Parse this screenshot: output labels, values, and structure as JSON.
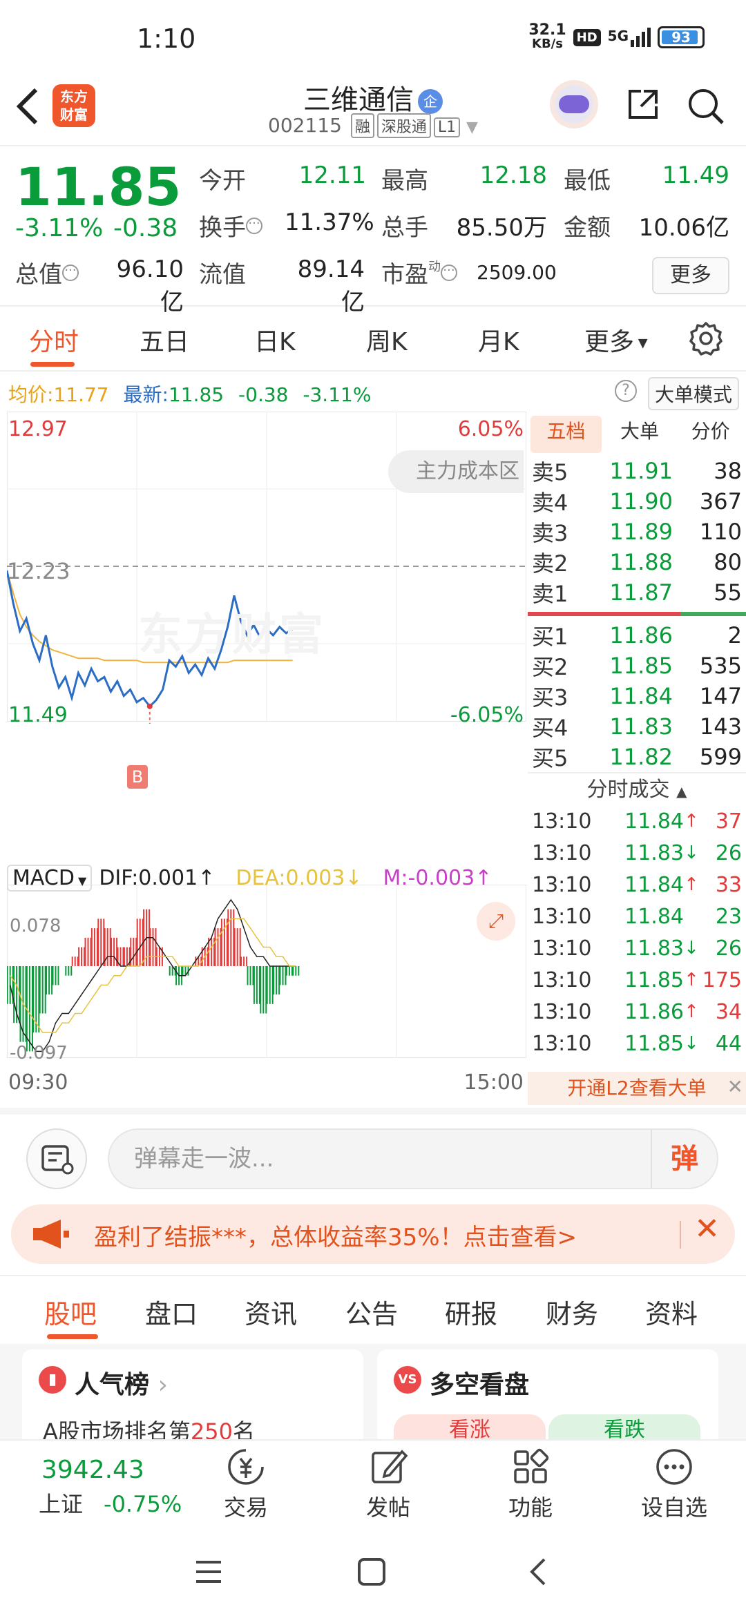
{
  "status": {
    "time": "1:10",
    "net_speed": "32.1",
    "net_unit": "KB/s",
    "hd": "HD",
    "signal": "5G",
    "battery": "93"
  },
  "header": {
    "back_icon": "chevron-left-icon",
    "logo_line1": "东方",
    "logo_line2": "财富",
    "stock_name": "三维通信",
    "badge": "企",
    "code": "002115",
    "tags": [
      "融",
      "深股通",
      "L1"
    ]
  },
  "quote": {
    "price": "11.85",
    "change_pct": "-3.11%",
    "change": "-0.38",
    "open_label": "今开",
    "open": "12.11",
    "high_label": "最高",
    "high": "12.18",
    "low_label": "最低",
    "low": "11.49",
    "turnover_label": "换手",
    "turnover": "11.37%",
    "volume_label": "总手",
    "volume": "85.50万",
    "amount_label": "金额",
    "amount": "10.06亿",
    "mktcap_label": "总值",
    "mktcap": "96.10亿",
    "float_label": "流值",
    "float": "89.14亿",
    "pe_label": "市盈",
    "pe_sup": "动",
    "pe": "2509.00",
    "more": "更多"
  },
  "period_tabs": [
    "分时",
    "五日",
    "日K",
    "周K",
    "月K",
    "更多"
  ],
  "info": {
    "avg_label": "均价:",
    "avg": "11.77",
    "latest_label": "最新:",
    "latest": "11.85",
    "latest_chg": "-0.38",
    "latest_pct": "-3.11%",
    "big_order": "大单模式"
  },
  "chart_labels": {
    "y_top": "12.97",
    "pct_top": "6.05%",
    "y_mid": "12.23",
    "y_bottom": "11.49",
    "pct_bottom": "-6.05%",
    "cost_zone": "主力成本区",
    "watermark": "东方财富",
    "b_marker": "B",
    "macd_selector": "MACD",
    "dif": "DIF:0.001",
    "dea": "DEA:0.003",
    "m": "M:-0.003",
    "macd_top": "0.078",
    "macd_bottom": "-0.097",
    "time_start": "09:30",
    "time_end": "15:00"
  },
  "chart_data": {
    "type": "line",
    "title": "",
    "xlim": [
      "09:30",
      "15:00"
    ],
    "ylim": [
      11.49,
      12.97
    ],
    "reference_price": 12.23,
    "series": [
      {
        "values": [
          12.21,
          12.05,
          11.92,
          11.98,
          11.86,
          11.78,
          11.9,
          11.75,
          11.65,
          11.7,
          11.6,
          11.72,
          11.66,
          11.74,
          11.68,
          11.7,
          11.63,
          11.68,
          11.61,
          11.64,
          11.58,
          11.6,
          11.56,
          11.59,
          11.64,
          11.78,
          11.75,
          11.8,
          11.72,
          11.76,
          11.71,
          11.79,
          11.74,
          11.83,
          11.94,
          12.09,
          11.97,
          11.9,
          11.95,
          11.89,
          11.93,
          11.9,
          11.94,
          11.91,
          11.93
        ]
      },
      {
        "values": [
          12.21,
          12.1,
          12.0,
          11.94,
          11.9,
          11.87,
          11.85,
          11.83,
          11.82,
          11.81,
          11.8,
          11.79,
          11.79,
          11.79,
          11.79,
          11.78,
          11.78,
          11.78,
          11.78,
          11.78,
          11.78,
          11.77,
          11.77,
          11.77,
          11.77,
          11.77,
          11.77,
          11.77,
          11.77,
          11.77,
          11.77,
          11.77,
          11.77,
          11.77,
          11.77,
          11.78,
          11.78,
          11.78,
          11.78,
          11.78,
          11.78,
          11.78,
          11.78,
          11.78,
          11.78
        ]
      }
    ],
    "macd": {
      "ylim": [
        -0.097,
        0.078
      ],
      "bars": [
        -0.04,
        -0.06,
        -0.08,
        -0.09,
        -0.07,
        -0.05,
        -0.03,
        -0.02,
        0.0,
        -0.01,
        0.01,
        0.02,
        0.03,
        0.04,
        0.05,
        0.04,
        0.03,
        0.02,
        0.02,
        0.03,
        0.05,
        0.06,
        0.04,
        0.02,
        0.0,
        -0.01,
        -0.02,
        -0.01,
        0.0,
        0.01,
        0.02,
        0.03,
        0.04,
        0.05,
        0.06,
        0.04,
        0.01,
        -0.02,
        -0.04,
        -0.05,
        -0.04,
        -0.03,
        -0.02,
        -0.01,
        -0.01
      ],
      "dif": [
        -0.02,
        -0.05,
        -0.07,
        -0.08,
        -0.09,
        -0.09,
        -0.08,
        -0.06,
        -0.05,
        -0.05,
        -0.04,
        -0.03,
        -0.02,
        -0.01,
        0.0,
        0.01,
        0.01,
        0.0,
        0.0,
        0.01,
        0.02,
        0.03,
        0.03,
        0.02,
        0.01,
        0.0,
        -0.01,
        -0.01,
        0.0,
        0.01,
        0.02,
        0.03,
        0.05,
        0.06,
        0.07,
        0.06,
        0.04,
        0.02,
        0.01,
        0.01,
        0.0,
        0.0,
        0.0,
        0.0,
        0.0
      ],
      "dea": [
        -0.01,
        -0.02,
        -0.04,
        -0.05,
        -0.06,
        -0.07,
        -0.07,
        -0.07,
        -0.06,
        -0.06,
        -0.05,
        -0.05,
        -0.04,
        -0.03,
        -0.02,
        -0.02,
        -0.01,
        -0.01,
        0.0,
        0.0,
        0.0,
        0.01,
        0.01,
        0.01,
        0.01,
        0.01,
        0.0,
        0.0,
        0.0,
        0.0,
        0.01,
        0.02,
        0.03,
        0.04,
        0.05,
        0.05,
        0.05,
        0.04,
        0.03,
        0.02,
        0.02,
        0.01,
        0.01,
        0.0,
        0.0
      ]
    },
    "colors": {
      "price": "#2b6cc4",
      "avg": "#f2b33d",
      "up": "#e23b3b",
      "down": "#0a9b3b",
      "dif": "#222222",
      "dea": "#e7c23d"
    }
  },
  "book": {
    "tabs": [
      "五档",
      "大单",
      "分价"
    ],
    "sells": [
      {
        "label": "卖5",
        "price": "11.91",
        "vol": "38"
      },
      {
        "label": "卖4",
        "price": "11.90",
        "vol": "367"
      },
      {
        "label": "卖3",
        "price": "11.89",
        "vol": "110"
      },
      {
        "label": "卖2",
        "price": "11.88",
        "vol": "80"
      },
      {
        "label": "卖1",
        "price": "11.87",
        "vol": "55"
      }
    ],
    "buys": [
      {
        "label": "买1",
        "price": "11.86",
        "vol": "2"
      },
      {
        "label": "买2",
        "price": "11.85",
        "vol": "535"
      },
      {
        "label": "买3",
        "price": "11.84",
        "vol": "147"
      },
      {
        "label": "买4",
        "price": "11.83",
        "vol": "143"
      },
      {
        "label": "买5",
        "price": "11.82",
        "vol": "599"
      }
    ],
    "trades_title": "分时成交",
    "trades": [
      {
        "time": "13:10",
        "price": "11.84",
        "dir": "up",
        "vol": "37"
      },
      {
        "time": "13:10",
        "price": "11.83",
        "dir": "down",
        "vol": "26"
      },
      {
        "time": "13:10",
        "price": "11.84",
        "dir": "up",
        "vol": "33"
      },
      {
        "time": "13:10",
        "price": "11.84",
        "dir": "none",
        "vol": "23"
      },
      {
        "time": "13:10",
        "price": "11.83",
        "dir": "down",
        "vol": "26"
      },
      {
        "time": "13:10",
        "price": "11.85",
        "dir": "up",
        "vol": "175"
      },
      {
        "time": "13:10",
        "price": "11.86",
        "dir": "up",
        "vol": "34"
      },
      {
        "time": "13:10",
        "price": "11.85",
        "dir": "down",
        "vol": "44"
      }
    ],
    "l2_promo": "开通L2查看大单"
  },
  "danmu": {
    "placeholder": "弹幕走一波...",
    "send": "弹"
  },
  "promo": {
    "text": "盈利了结振***，总体收益率35%！点击查看>"
  },
  "content_tabs": [
    "股吧",
    "盘口",
    "资讯",
    "公告",
    "研报",
    "财务",
    "资料"
  ],
  "cards": {
    "popularity_title": "人气榜",
    "popularity_sub_prefix": "A股市场排名第",
    "popularity_rank": "250",
    "popularity_sub_suffix": "名",
    "vs_title": "多空看盘",
    "vs_icon": "VS",
    "bull": "看涨",
    "bear": "看跌"
  },
  "bottom": {
    "index_value": "3942.43",
    "index_name": "上证",
    "index_chg": "-0.75%",
    "items": [
      "交易",
      "发帖",
      "功能",
      "设自选"
    ]
  }
}
